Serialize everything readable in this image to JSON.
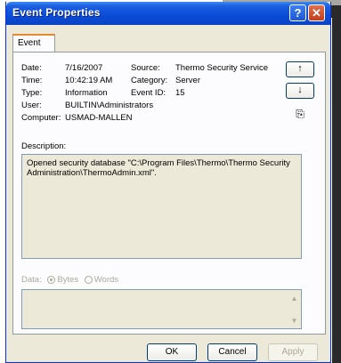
{
  "window": {
    "title": "Event Properties",
    "help_glyph": "?",
    "close_glyph": "✕"
  },
  "tabs": [
    {
      "label": "Event"
    }
  ],
  "event": {
    "date_label": "Date:",
    "date": "7/16/2007",
    "source_label": "Source:",
    "source": "Thermo Security Service",
    "time_label": "Time:",
    "time": "10:42:19 AM",
    "category_label": "Category:",
    "category": "Server",
    "type_label": "Type:",
    "type": "Information",
    "event_id_label": "Event ID:",
    "event_id": "15",
    "user_label": "User:",
    "user": "BUILTIN\\Administrators",
    "computer_label": "Computer:",
    "computer": "USMAD-MALLEN"
  },
  "nav": {
    "up_glyph": "↑",
    "down_glyph": "↓",
    "copy_glyph": "⎘"
  },
  "description": {
    "label": "Description:",
    "text": "Opened security database \"C:\\Program Files\\Thermo\\Thermo Security Administration\\ThermoAdmin.xml\"."
  },
  "data": {
    "label": "Data:",
    "bytes_label": "Bytes",
    "words_label": "Words",
    "selected": "Bytes"
  },
  "buttons": {
    "ok": "OK",
    "cancel": "Cancel",
    "apply": "Apply"
  }
}
